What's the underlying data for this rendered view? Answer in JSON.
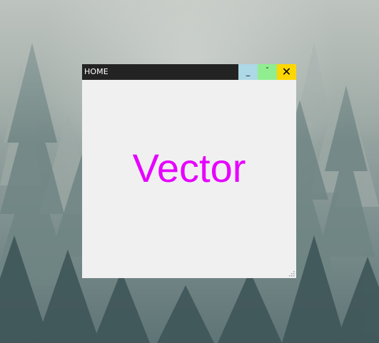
{
  "window": {
    "title": "HOME",
    "controls": {
      "minimize": {
        "glyph": "_",
        "color": "#add8e6"
      },
      "maximize": {
        "glyph": "-",
        "color": "#90ee90"
      },
      "close": {
        "glyph": "✕",
        "color": "#ffd700"
      }
    },
    "content": {
      "headline": "Vector",
      "headline_color": "#e600ff"
    },
    "resize_icon": "resize-grip-icon"
  },
  "desktop": {
    "background": "misty-forest-wallpaper"
  }
}
